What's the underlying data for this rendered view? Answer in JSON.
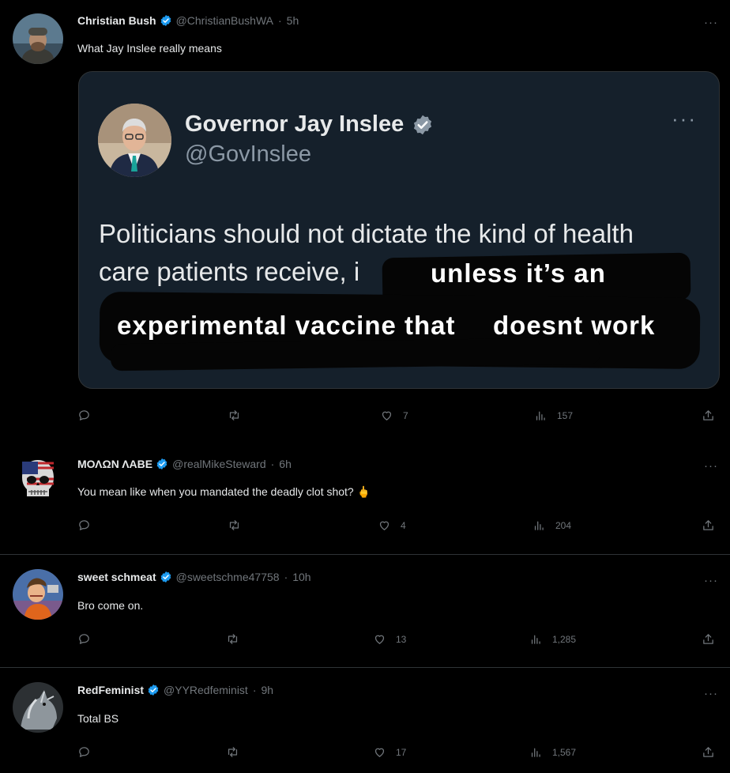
{
  "tweets": [
    {
      "name": "Christian Bush",
      "handle": "@ChristianBushWA",
      "time": "5h",
      "text": "What Jay Inslee really means",
      "replies": "",
      "retweets": "",
      "likes": "7",
      "views": "157"
    },
    {
      "name": "ΜΟΛΩΝ ΛΑΒΕ",
      "handle": "@realMikeSteward",
      "time": "6h",
      "text": "You mean like when you mandated the deadly clot shot? 🖕",
      "replies": "",
      "retweets": "",
      "likes": "4",
      "views": "204"
    },
    {
      "name": "sweet schmeat",
      "handle": "@sweetschme47758",
      "time": "10h",
      "text": "Bro come on.",
      "replies": "",
      "retweets": "",
      "likes": "13",
      "views": "1,285"
    },
    {
      "name": "RedFeminist",
      "handle": "@YYRedfeminist",
      "time": "9h",
      "text": "Total BS",
      "replies": "",
      "retweets": "",
      "likes": "17",
      "views": "1,567"
    }
  ],
  "embed": {
    "name": "Governor Jay Inslee",
    "handle": "@GovInslee",
    "line1": "Politicians should not dictate the kind of health",
    "line2": "care patients receive, i",
    "overlay1": "unless it’s an",
    "overlay2a": "experimental vaccine that",
    "overlay2b": "doesnt work"
  },
  "ui": {
    "more_glyph": "···",
    "dot": "·"
  },
  "colors": {
    "background": "#000000",
    "verified": "#1d9bf0",
    "muted": "#71767b",
    "embed_bg": "#15202b"
  },
  "icons": [
    "reply-icon",
    "retweet-icon",
    "like-icon",
    "views-icon",
    "share-icon",
    "verified-icon",
    "more-icon"
  ]
}
